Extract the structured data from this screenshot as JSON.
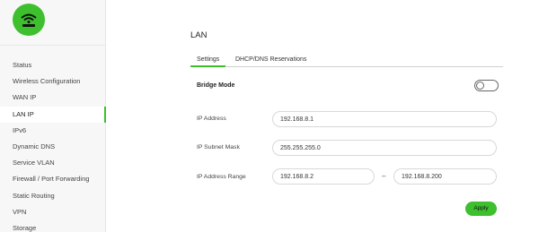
{
  "sidebar": {
    "logo_icon": "wifi-router-icon",
    "items": [
      {
        "label": "Status"
      },
      {
        "label": "Wireless Configuration"
      },
      {
        "label": "WAN IP"
      },
      {
        "label": "LAN IP",
        "active": true
      },
      {
        "label": "IPv6"
      },
      {
        "label": "Dynamic DNS"
      },
      {
        "label": "Service VLAN"
      },
      {
        "label": "Firewall / Port Forwarding"
      },
      {
        "label": "Static Routing"
      },
      {
        "label": "VPN"
      },
      {
        "label": "Storage"
      }
    ]
  },
  "main": {
    "title": "LAN",
    "tabs": [
      {
        "label": "Settings",
        "active": true
      },
      {
        "label": "DHCP/DNS Reservations",
        "active": false
      }
    ],
    "bridge_mode": {
      "label": "Bridge Mode",
      "enabled": false
    },
    "ip_address": {
      "label": "IP Address",
      "value": "192.168.8.1"
    },
    "subnet_mask": {
      "label": "IP Subnet Mask",
      "value": "255.255.255.0"
    },
    "ip_range": {
      "label": "IP Address Range",
      "start": "192.168.8.2",
      "separator": "–",
      "end": "192.168.8.200"
    },
    "apply_label": "Apply"
  },
  "colors": {
    "accent": "#3dbf2e",
    "sidebar_bg": "#f7f7f7"
  }
}
